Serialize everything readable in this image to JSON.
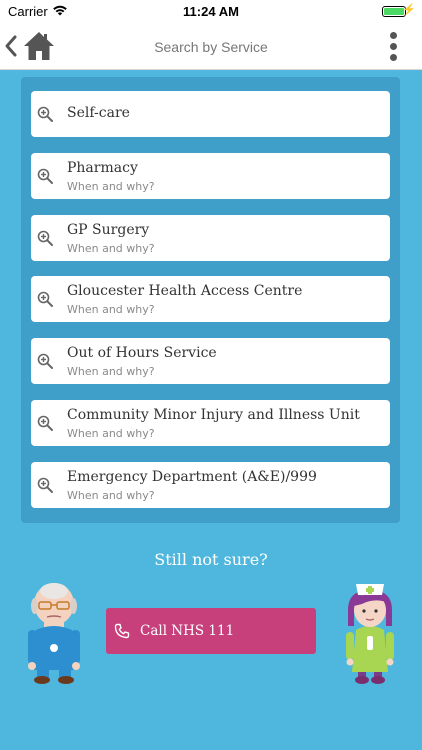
{
  "status_bar": {
    "carrier": "Carrier",
    "time": "11:24 AM"
  },
  "nav": {
    "title": "Search by Service",
    "back_icon": "chevron-left-icon",
    "home_icon": "home-icon",
    "menu_icon": "more-vertical-icon"
  },
  "services": [
    {
      "label": "Self-care",
      "subtitle": ""
    },
    {
      "label": "Pharmacy",
      "subtitle": "When and why?"
    },
    {
      "label": "GP Surgery",
      "subtitle": "When and why?"
    },
    {
      "label": "Gloucester Health Access Centre",
      "subtitle": "When and why?"
    },
    {
      "label": "Out of Hours Service",
      "subtitle": "When and why?"
    },
    {
      "label": "Community Minor Injury and Illness Unit",
      "subtitle": "When and why?"
    },
    {
      "label": "Emergency Department (A&E)/999",
      "subtitle": "When and why?"
    }
  ],
  "footer": {
    "prompt": "Still not sure?",
    "call_label": "Call NHS 111"
  },
  "colors": {
    "background": "#4fb7dd",
    "panel": "#3f9fc8",
    "call_button": "#c7407c",
    "battery": "#4cd964"
  }
}
